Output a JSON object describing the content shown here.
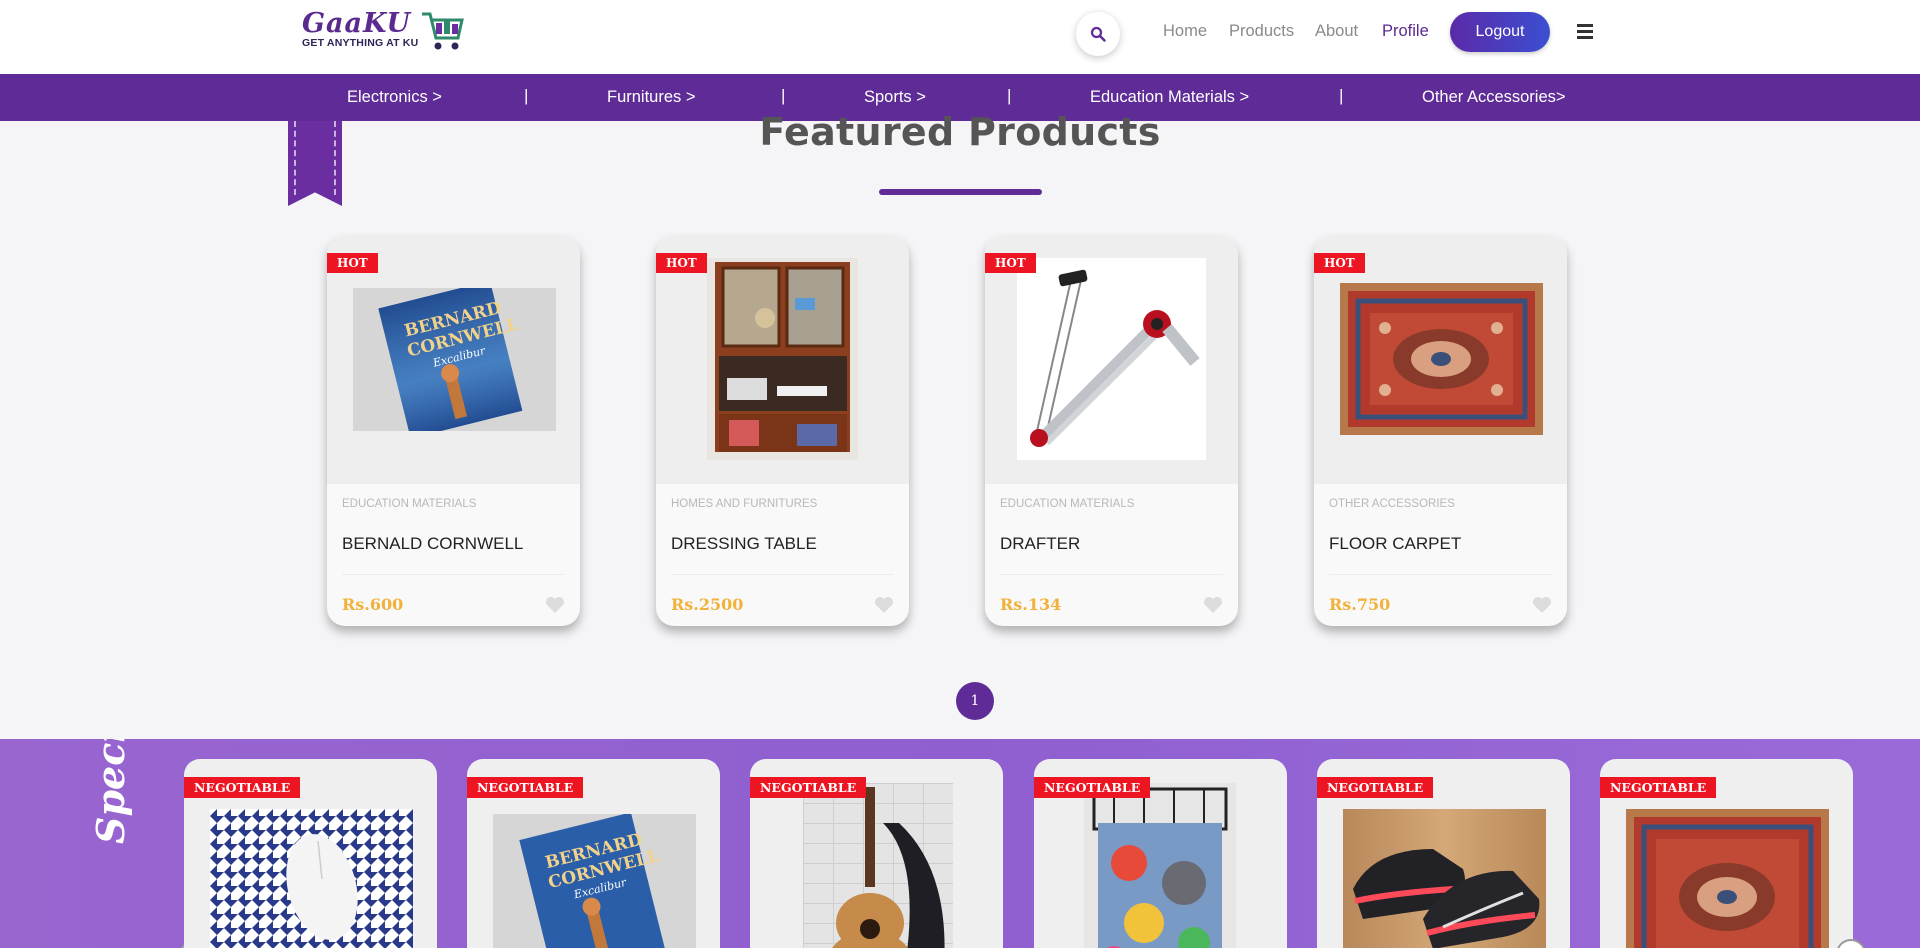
{
  "header": {
    "logo_text": "GaaKU",
    "logo_tagline": "GET ANYTHING AT KU",
    "nav": [
      "Home",
      "Products",
      "About",
      "Profile"
    ],
    "logout_label": "Logout"
  },
  "categories": [
    "Electronics >",
    "Furnitures >",
    "Sports >",
    "Education Materials >",
    "Other Accessories>"
  ],
  "category_separator": "|",
  "featured": {
    "title": "Featured Products",
    "badge": "HOT",
    "products": [
      {
        "category": "EDUCATION MATERIALS",
        "name": "BERNALD CORNWELL",
        "price": "Rs.600",
        "image": "book"
      },
      {
        "category": "HOMES AND FURNITURES",
        "name": "DRESSING TABLE",
        "price": "Rs.2500",
        "image": "cabinet"
      },
      {
        "category": "EDUCATION MATERIALS",
        "name": "DRAFTER",
        "price": "Rs.134",
        "image": "drafter"
      },
      {
        "category": "OTHER ACCESSORIES",
        "name": "FLOOR CARPET",
        "price": "Rs.750",
        "image": "carpet"
      }
    ],
    "page": "1"
  },
  "special_offers": {
    "title": "Special offers",
    "badge": "NEGOTIABLE",
    "items": [
      "mouse",
      "book",
      "guitar",
      "bedding",
      "shoes",
      "carpet"
    ]
  },
  "colors": {
    "brand_purple": "#5e2b97",
    "badge_red": "#ee1522",
    "price_gold": "#f2b13a"
  }
}
